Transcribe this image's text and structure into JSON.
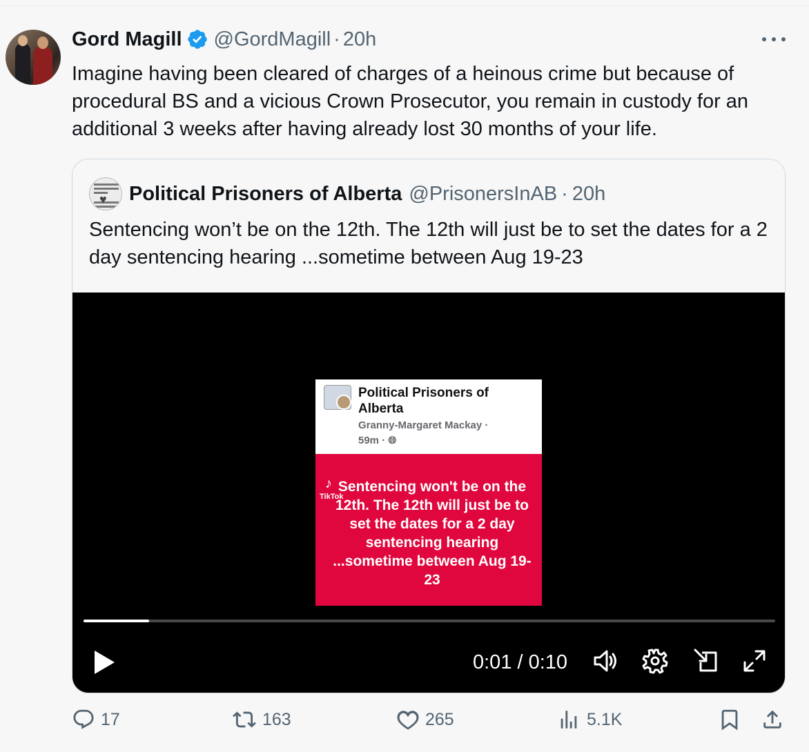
{
  "tweet": {
    "author_name": "Gord Magill",
    "handle": "@GordMagill",
    "separator": "·",
    "time": "20h",
    "text": "Imagine having been cleared of charges of a heinous crime but because of procedural BS and a vicious Crown Prosecutor, you remain in custody for an additional 3 weeks after having already lost 30 months of your life."
  },
  "quote": {
    "author_name": "Political Prisoners of Alberta",
    "handle": "@PrisonersInAB",
    "separator": "·",
    "time": "20h",
    "text": "Sentencing won’t be on the 12th.  The 12th will just be to set the dates for a 2 day sentencing hearing ...sometime between Aug 19-23"
  },
  "video": {
    "frame_title": "Political Prisoners of Alberta",
    "frame_subtitle": "Granny-Margaret Mackay ·",
    "frame_time": "59m ·",
    "frame_message": "Sentencing won't be on the 12th.  The 12th will just be to set the dates for a 2 day sentencing hearing ...sometime between Aug 19-23",
    "tiktok_label": "TikTok",
    "timecode": "0:01 / 0:10",
    "progress_fraction": 0.095
  },
  "actions": {
    "replies": "17",
    "reposts": "163",
    "likes": "265",
    "views": "5.1K"
  },
  "colors": {
    "verified": "#1d9bf0",
    "muted": "#536471",
    "card_red": "#e0073e"
  }
}
